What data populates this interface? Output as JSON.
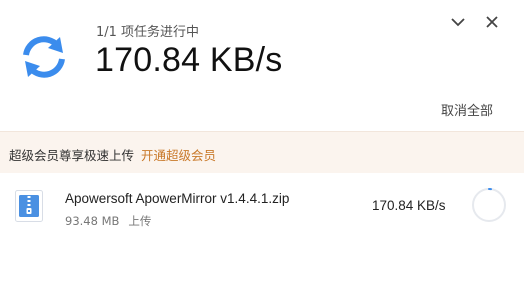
{
  "header": {
    "task_status": "1/1 项任务进行中",
    "total_speed": "170.84 KB/s",
    "cancel_all_label": "取消全部",
    "icons": {
      "main": "sync-icon",
      "collapse": "chevron-down-icon",
      "close": "close-icon"
    }
  },
  "promo": {
    "text": "超级会员尊享极速上传",
    "link_label": "开通超级会员"
  },
  "files": [
    {
      "name": "Apowersoft ApowerMirror v1.4.4.1.zip",
      "size": "93.48 MB",
      "status": "上传",
      "speed": "170.84 KB/s",
      "icon": "zip-file-icon",
      "progress": 0.02
    }
  ],
  "colors": {
    "accent": "#3b8ced",
    "promo_bg": "#fbf4ee",
    "promo_link": "#c9792a"
  }
}
